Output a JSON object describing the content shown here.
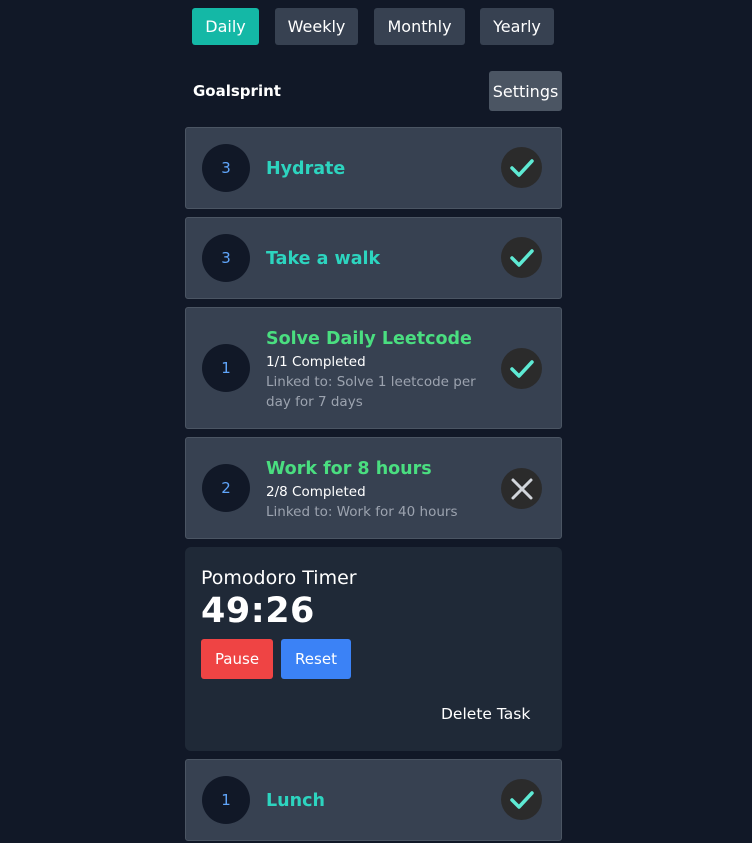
{
  "tabs": [
    {
      "label": "Daily",
      "active": true
    },
    {
      "label": "Weekly",
      "active": false
    },
    {
      "label": "Monthly",
      "active": false
    },
    {
      "label": "Yearly",
      "active": false
    }
  ],
  "header": {
    "brand": "Goalsprint",
    "settings_label": "Settings"
  },
  "tasks": [
    {
      "count": "3",
      "title": "Hydrate",
      "status": "done"
    },
    {
      "count": "3",
      "title": "Take a walk",
      "status": "done"
    },
    {
      "count": "1",
      "title": "Solve Daily Leetcode",
      "progress": "1/1 Completed",
      "linked": "Linked to: Solve 1 leetcode per day for 7 days",
      "status": "done"
    },
    {
      "count": "2",
      "title": "Work for 8 hours",
      "progress": "2/8 Completed",
      "linked": "Linked to: Work for 40 hours",
      "status": "not-done"
    },
    {
      "count": "1",
      "title": "Lunch",
      "status": "done"
    }
  ],
  "pomodoro": {
    "title": "Pomodoro Timer",
    "time": "49:26",
    "pause_label": "Pause",
    "reset_label": "Reset",
    "delete_label": "Delete Task"
  },
  "colors": {
    "background": "#111827",
    "card": "#374151",
    "accent_teal": "#14b8a6",
    "title_teal": "#2dd4bf",
    "title_green": "#4ade80",
    "pause": "#ef4444",
    "reset": "#3b82f6"
  }
}
